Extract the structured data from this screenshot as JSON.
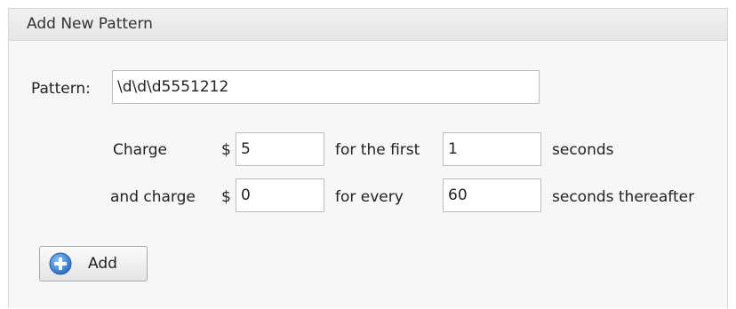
{
  "panel": {
    "title": "Add New Pattern"
  },
  "pattern": {
    "label": "Pattern:",
    "value": "\\d\\d\\d5551212"
  },
  "charge_row": {
    "label": "Charge",
    "currency": "$",
    "amount": "5",
    "middle_label": "for the first",
    "seconds_value": "1",
    "suffix": "seconds"
  },
  "and_charge_row": {
    "label": "and charge",
    "currency": "$",
    "amount": "0",
    "middle_label": "for every",
    "seconds_value": "60",
    "suffix": "seconds thereafter"
  },
  "add_button": {
    "label": "Add",
    "icon": "plus-circle-icon",
    "icon_color": "#3b7fd0"
  }
}
